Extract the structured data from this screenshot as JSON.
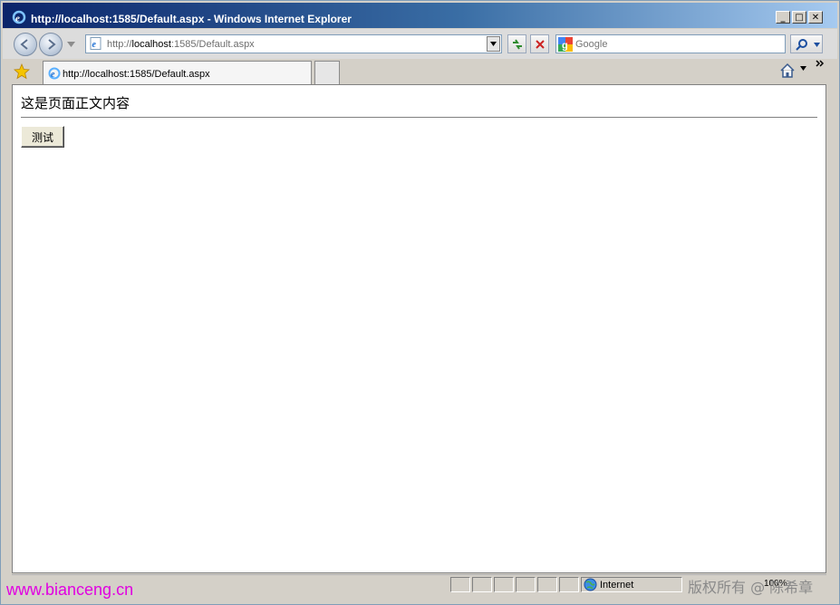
{
  "window": {
    "title": "http://localhost:1585/Default.aspx - Windows Internet Explorer",
    "buttons": {
      "minimize": "_",
      "maximize": "□",
      "close": "✕"
    }
  },
  "nav": {
    "address_prefix": "http://",
    "address_host": "localhost",
    "address_rest": ":1585/Default.aspx",
    "search_placeholder": "Google"
  },
  "tabs": [
    {
      "label": "http://localhost:1585/Default.aspx",
      "active": true
    }
  ],
  "content": {
    "body_text": "这是页面正文内容",
    "button_label": "测试"
  },
  "status": {
    "zone": "Internet",
    "zoom": "100%"
  },
  "overlay": {
    "watermark": "www.bianceng.cn",
    "copyright": "版权所有 @ 陈希章"
  },
  "colors": {
    "title_gradient_start": "#0a246a",
    "title_gradient_end": "#a6caf0",
    "watermark": "#e100e1"
  }
}
